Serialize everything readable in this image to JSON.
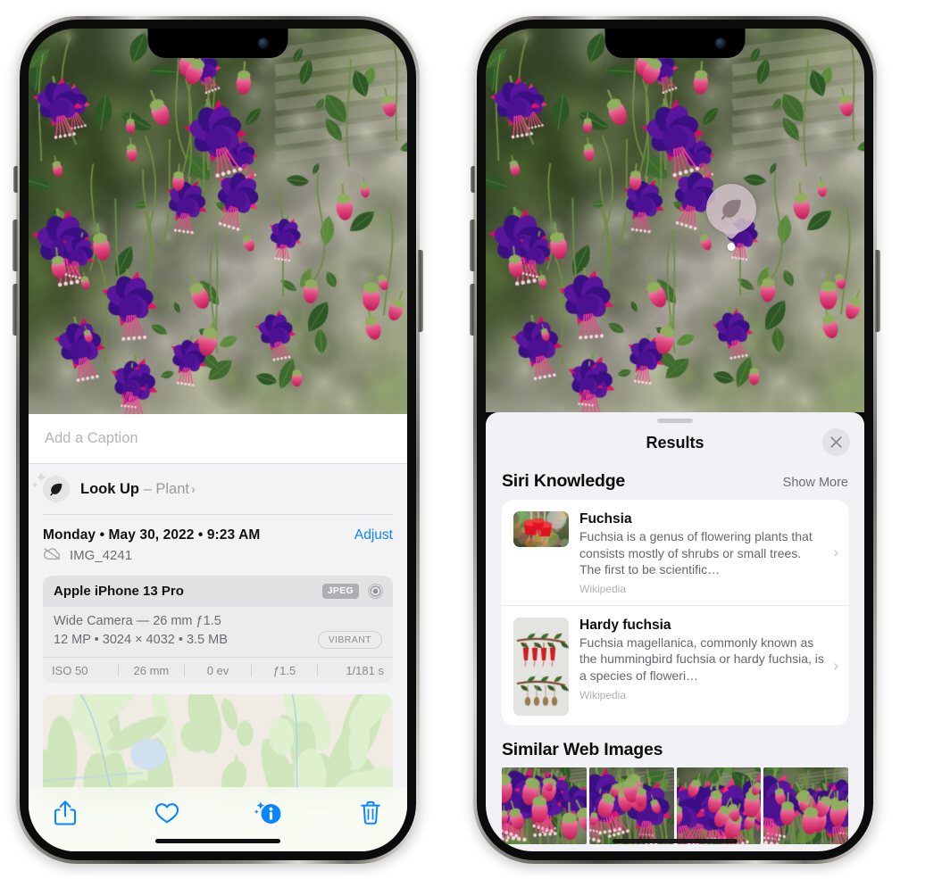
{
  "left_phone": {
    "photo_alt": "fuchsia-flowers-photo",
    "caption_placeholder": "Add a Caption",
    "lookup": {
      "icon": "leaf-icon",
      "label": "Look Up",
      "dash": " – ",
      "subject": "Plant",
      "chevron": "›"
    },
    "date_line": "Monday • May 30, 2022 • 9:23 AM",
    "adjust_label": "Adjust",
    "cloud_icon": "icloud-slash-icon",
    "file_name": "IMG_4241",
    "camera_card": {
      "model": "Apple iPhone 13 Pro",
      "format_badge": "JPEG",
      "lens_icon": "aperture-icon",
      "lens_line": "Wide Camera — 26 mm ƒ1.5",
      "specs_line": "12 MP • 3024 × 4032 • 3.5 MB",
      "style_badge": "VIBRANT",
      "exif": [
        "ISO 50",
        "26 mm",
        "0 ev",
        "ƒ1.5",
        "1/181 s"
      ]
    },
    "map_alt": "location-map",
    "toolbar": [
      {
        "name": "share-button",
        "icon": "share-icon"
      },
      {
        "name": "favorite-button",
        "icon": "heart-icon"
      },
      {
        "name": "info-button",
        "icon": "info-sparkle-icon"
      },
      {
        "name": "delete-button",
        "icon": "trash-icon"
      }
    ]
  },
  "right_phone": {
    "photo_alt": "fuchsia-flowers-photo",
    "lookup_pin": {
      "icon": "leaf-icon"
    },
    "sheet": {
      "title": "Results",
      "close_icon": "close-icon",
      "siri_knowledge": {
        "title": "Siri Knowledge",
        "show_more": "Show More",
        "items": [
          {
            "title": "Fuchsia",
            "description": "Fuchsia is a genus of flowering plants that consists mostly of shrubs or small trees. The first to be scientific…",
            "source": "Wikipedia",
            "chevron": "›",
            "thumb_alt": "fuchsia-red-flowers-thumbnail"
          },
          {
            "title": "Hardy fuchsia",
            "description": "Fuchsia magellanica, commonly known as the hummingbird fuchsia or hardy fuchsia, is a species of floweri…",
            "source": "Wikipedia",
            "chevron": "›",
            "thumb_alt": "hardy-fuchsia-specimen-thumbnail"
          }
        ]
      },
      "similar_web_images": {
        "title": "Similar Web Images",
        "images": [
          {
            "alt": "fuchsia-pink-purple-web-image-1"
          },
          {
            "alt": "fuchsia-red-closeup-web-image-2"
          },
          {
            "alt": "fuchsia-bush-web-image-3"
          },
          {
            "alt": "fuchsia-purple-magenta-web-image-4"
          }
        ]
      }
    }
  },
  "colors": {
    "accent_blue": "#0a84ff",
    "sheet_gray": "#f1f1f6",
    "card_white": "#ffffff",
    "text_primary": "#111111",
    "text_secondary": "#6c6c71",
    "badge_gray": "#aeaeb4"
  }
}
